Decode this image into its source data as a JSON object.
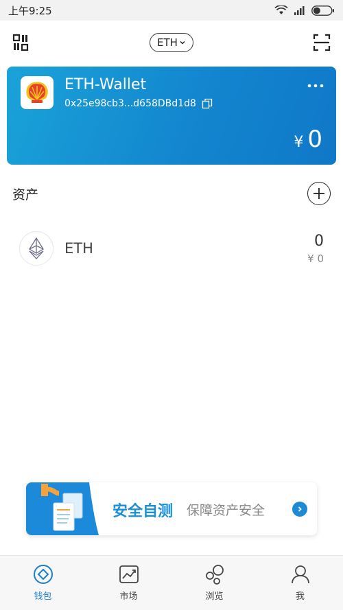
{
  "status_bar": {
    "time": "上午9:25"
  },
  "top_bar": {
    "chain": "ETH"
  },
  "wallet": {
    "name": "ETH-Wallet",
    "address": "0x25e98cb3...d658DBd1d8",
    "currency_symbol": "¥",
    "balance": "0"
  },
  "assets": {
    "title": "资产",
    "items": [
      {
        "name": "ETH",
        "amount": "0",
        "fiat": "¥ 0"
      }
    ]
  },
  "promo": {
    "title": "安全自测",
    "subtitle": "保障资产安全"
  },
  "tabs": [
    {
      "label": "钱包",
      "active": true
    },
    {
      "label": "市场",
      "active": false
    },
    {
      "label": "浏览",
      "active": false
    },
    {
      "label": "我",
      "active": false
    }
  ],
  "colors": {
    "accent": "#1386cf",
    "tab_active": "#1a7fd0"
  }
}
